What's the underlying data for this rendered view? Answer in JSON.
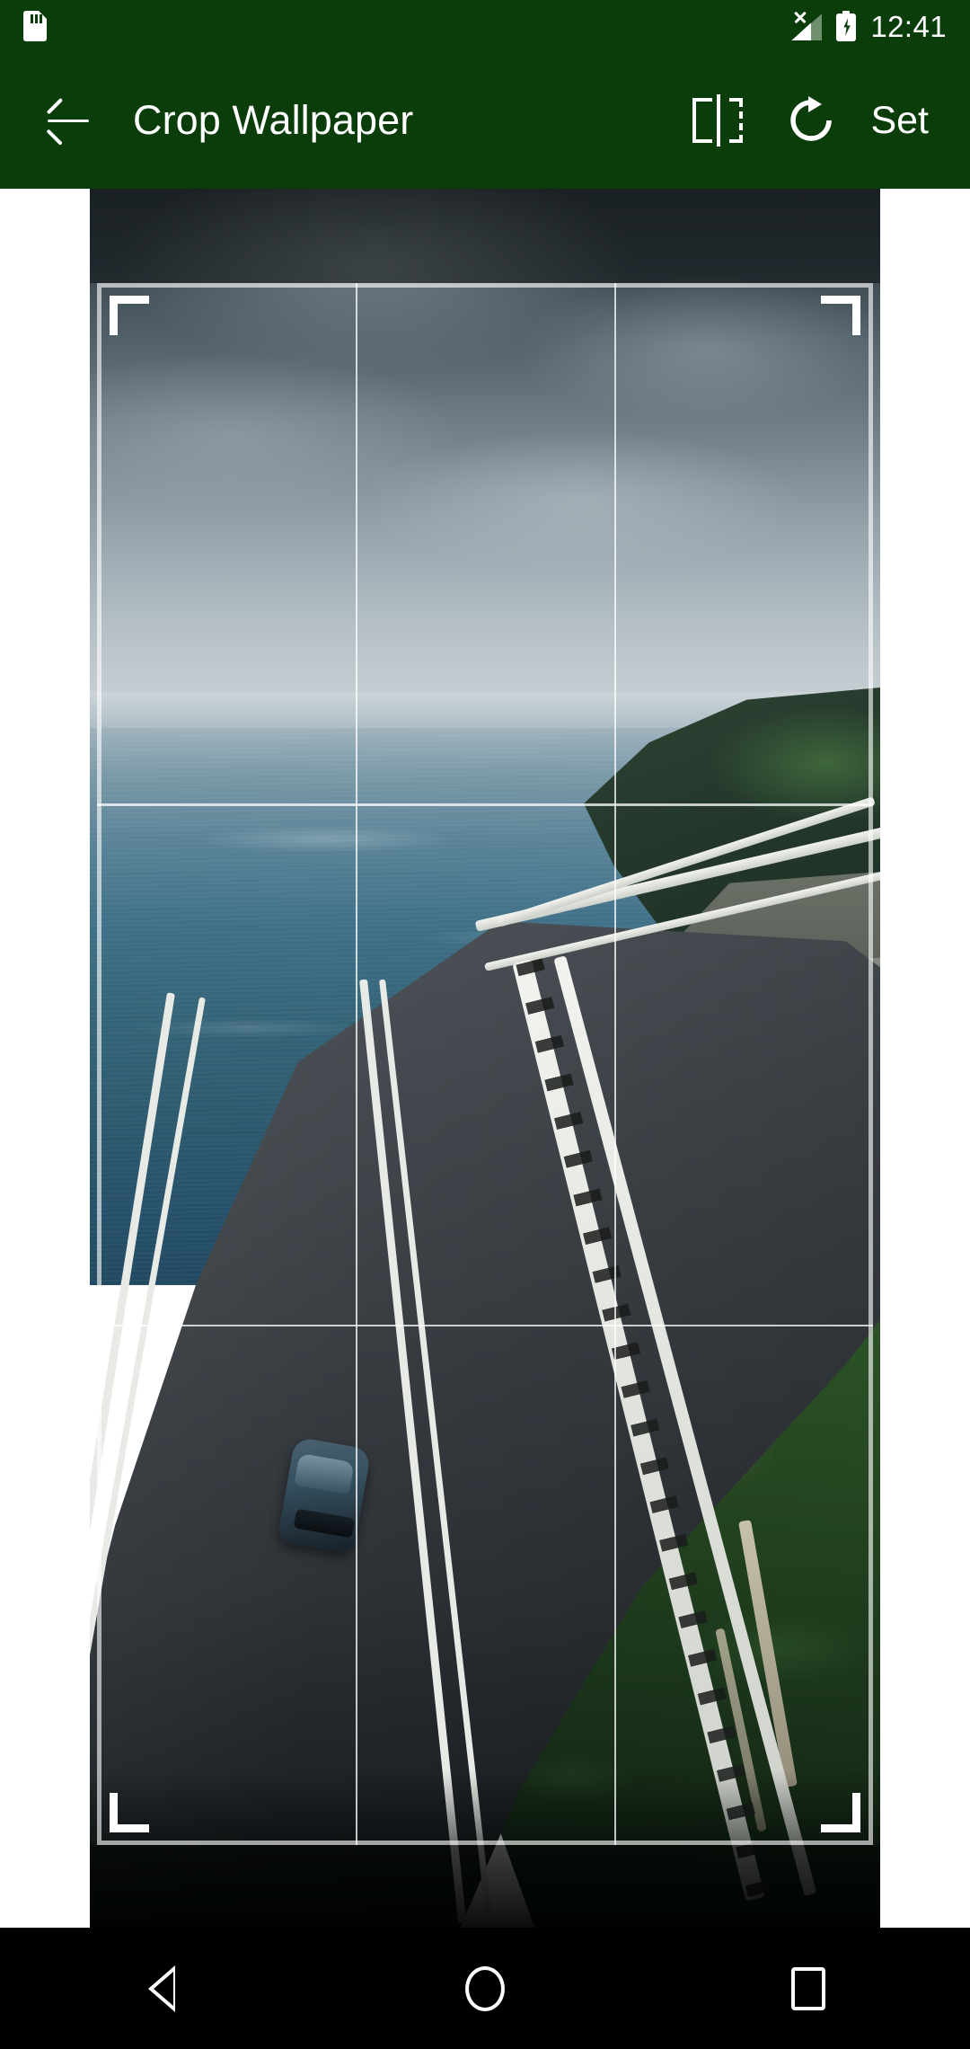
{
  "status_bar": {
    "time": "12:41",
    "icons": {
      "storage": "sd-card-icon",
      "signal": "signal-no-service-icon",
      "battery": "battery-charging-icon"
    }
  },
  "toolbar": {
    "back_label": "back-arrow-icon",
    "title": "Crop Wallpaper",
    "flip_label": "flip-icon",
    "rotate_label": "rotate-icon",
    "set_label": "Set"
  },
  "crop": {
    "grid": "rule-of-thirds",
    "handles": [
      "top-left",
      "top-right",
      "bottom-left",
      "bottom-right"
    ],
    "image_description": "Aerial photo of a curving coastal highway bridge over the ocean with a dark blue car, cloudy sky and green cliffside"
  },
  "nav_bar": {
    "back": "nav-back-icon",
    "home": "nav-home-icon",
    "recents": "nav-recents-icon"
  },
  "colors": {
    "toolbar": "#0b3d0b",
    "status_bar": "#0b3d0b",
    "nav_bar": "#000000",
    "page_background": "#ffffff",
    "crop_border": "#ffffff"
  }
}
